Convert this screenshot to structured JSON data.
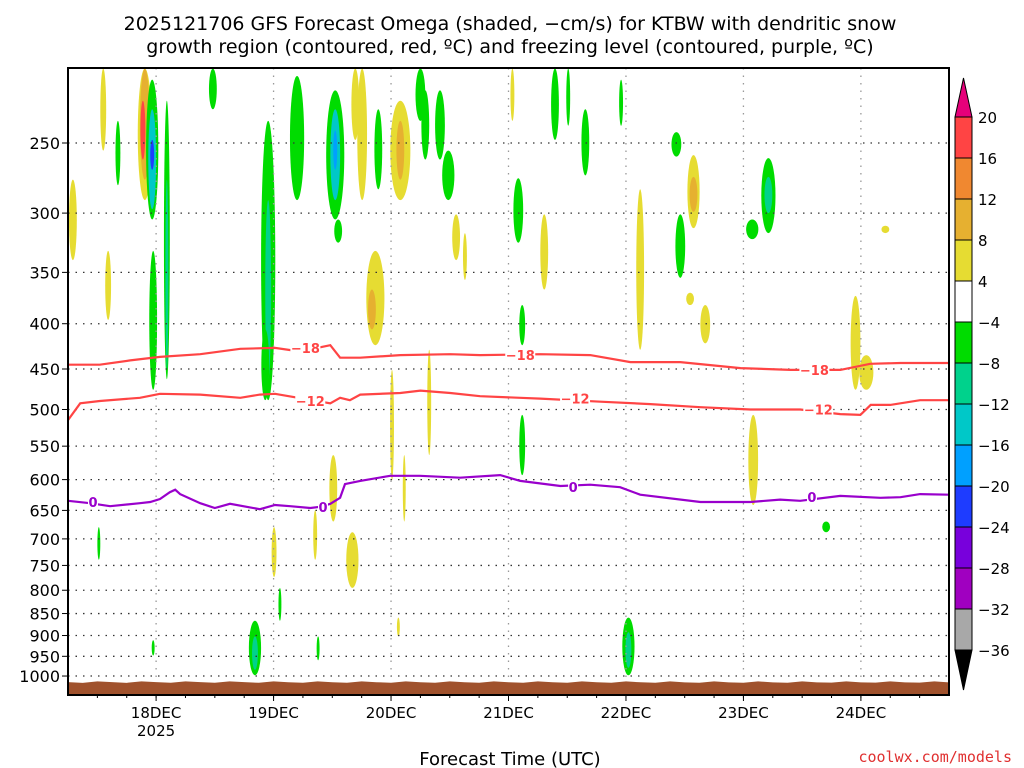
{
  "chart_data": {
    "type": "heatmap",
    "title_line1": "2025121706 GFS Forecast Omega (shaded, −cm/s) for KTBW with dendritic snow",
    "title_line2": "growth region (contoured, red, ºC) and freezing level (contoured, purple, ºC)",
    "xlabel": "Forecast Time (UTC)",
    "credit": "coolwx.com/models",
    "x_units": "hours since 2025-12-17 06Z",
    "xlim": [
      0,
      180
    ],
    "ylim_hPa": [
      206,
      1050
    ],
    "y_scale": "log",
    "y_ticks": [
      250,
      300,
      350,
      400,
      450,
      500,
      550,
      600,
      650,
      700,
      750,
      800,
      850,
      900,
      950,
      1000
    ],
    "x_ticks": [
      {
        "hour": 18,
        "label": "18DEC",
        "sub": "2025"
      },
      {
        "hour": 42,
        "label": "19DEC",
        "sub": ""
      },
      {
        "hour": 66,
        "label": "20DEC",
        "sub": ""
      },
      {
        "hour": 90,
        "label": "21DEC",
        "sub": ""
      },
      {
        "hour": 114,
        "label": "22DEC",
        "sub": ""
      },
      {
        "hour": 138,
        "label": "23DEC",
        "sub": ""
      },
      {
        "hour": 162,
        "label": "24DEC",
        "sub": ""
      }
    ],
    "grid": true,
    "colorbar": {
      "labels": [
        "20",
        "16",
        "12",
        "8",
        "4",
        "−4",
        "−8",
        "−12",
        "−16",
        "−20",
        "−24",
        "−28",
        "−32",
        "−36"
      ],
      "colors": [
        "#ff4444",
        "#f08830",
        "#e6b030",
        "#e6dc32",
        "#ffffff",
        "#00dc00",
        "#00d28c",
        "#00c8c8",
        "#00a0ff",
        "#1e3cff",
        "#7800dc",
        "#a000c0",
        "#a8a8a8"
      ],
      "over_color": "#e6007a",
      "under_color": "#000000"
    },
    "surface_pressure_hPa": 1016,
    "surface_color": "#a0522d",
    "omega_regions_fields": [
      "hour_center",
      "hour_width",
      "p_top",
      "p_bottom",
      "omega"
    ],
    "omega_regions": [
      [
        1.0,
        1.6,
        275,
        339,
        6
      ],
      [
        7.2,
        1.2,
        206,
        255,
        6
      ],
      [
        8.2,
        1.2,
        331,
        396,
        6
      ],
      [
        10.2,
        1.0,
        236,
        279,
        -6
      ],
      [
        15.7,
        2.9,
        206,
        290,
        6
      ],
      [
        15.7,
        2.0,
        206,
        275,
        10
      ],
      [
        15.3,
        1.0,
        224,
        261,
        18
      ],
      [
        17.2,
        2.5,
        212,
        305,
        -6
      ],
      [
        17.2,
        1.6,
        229,
        297,
        -14
      ],
      [
        17.2,
        0.8,
        248,
        268,
        -22
      ],
      [
        17.4,
        1.6,
        331,
        475,
        -6
      ],
      [
        20.2,
        1.2,
        224,
        462,
        -6
      ],
      [
        20.2,
        0.6,
        275,
        451,
        -10
      ],
      [
        29.6,
        1.6,
        206,
        229,
        -6
      ],
      [
        40.9,
        2.9,
        236,
        488,
        -6
      ],
      [
        40.9,
        1.2,
        290,
        462,
        -10
      ],
      [
        40.3,
        1.6,
        406,
        488,
        -6
      ],
      [
        46.8,
        2.9,
        210,
        290,
        -6
      ],
      [
        54.6,
        3.7,
        218,
        305,
        -6
      ],
      [
        54.6,
        2.0,
        229,
        290,
        -14
      ],
      [
        54.6,
        0.8,
        242,
        268,
        -18
      ],
      [
        55.2,
        1.6,
        305,
        324,
        -6
      ],
      [
        58.7,
        1.6,
        206,
        248,
        6
      ],
      [
        60.1,
        2.0,
        206,
        290,
        6
      ],
      [
        62.8,
        3.7,
        331,
        423,
        6
      ],
      [
        62.1,
        1.6,
        366,
        406,
        10
      ],
      [
        63.4,
        1.6,
        229,
        282,
        -6
      ],
      [
        67.9,
        4.1,
        224,
        290,
        6
      ],
      [
        67.9,
        1.6,
        236,
        275,
        10
      ],
      [
        72.0,
        2.0,
        206,
        236,
        -6
      ],
      [
        73.0,
        1.6,
        218,
        261,
        -6
      ],
      [
        76.0,
        2.0,
        218,
        261,
        -6
      ],
      [
        77.7,
        2.5,
        255,
        290,
        -6
      ],
      [
        79.3,
        1.6,
        301,
        339,
        6
      ],
      [
        81.1,
        0.8,
        316,
        357,
        6
      ],
      [
        90.8,
        0.8,
        206,
        236,
        6
      ],
      [
        92.0,
        2.0,
        274,
        324,
        -6
      ],
      [
        97.3,
        1.6,
        301,
        366,
        6
      ],
      [
        99.5,
        1.6,
        206,
        248,
        -6
      ],
      [
        102.2,
        0.8,
        206,
        239,
        -6
      ],
      [
        105.7,
        1.6,
        229,
        272,
        -6
      ],
      [
        113.0,
        0.8,
        212,
        239,
        -6
      ],
      [
        116.9,
        1.6,
        282,
        428,
        6
      ],
      [
        124.3,
        2.0,
        243,
        259,
        -6
      ],
      [
        127.8,
        2.5,
        258,
        312,
        6
      ],
      [
        127.8,
        1.6,
        273,
        299,
        10
      ],
      [
        125.1,
        2.0,
        301,
        355,
        -6
      ],
      [
        130.2,
        2.0,
        381,
        421,
        6
      ],
      [
        127.1,
        1.6,
        369,
        381,
        6
      ],
      [
        143.1,
        2.9,
        260,
        316,
        -6
      ],
      [
        143.1,
        1.6,
        273,
        300,
        -10
      ],
      [
        139.8,
        2.5,
        305,
        321,
        -6
      ],
      [
        167.0,
        1.6,
        310,
        316,
        6
      ],
      [
        92.8,
        1.2,
        381,
        423,
        -6
      ],
      [
        160.9,
        2.0,
        372,
        475,
        6
      ],
      [
        163.1,
        2.9,
        434,
        475,
        6
      ],
      [
        140.0,
        2.0,
        507,
        641,
        6
      ],
      [
        154.9,
        1.6,
        669,
        688,
        -6
      ],
      [
        38.2,
        2.5,
        866,
        998,
        -6
      ],
      [
        38.2,
        1.2,
        902,
        984,
        -10
      ],
      [
        114.5,
        2.5,
        859,
        998,
        -6
      ],
      [
        114.5,
        1.2,
        892,
        979,
        -10
      ],
      [
        17.4,
        0.6,
        911,
        948,
        -6
      ],
      [
        51.1,
        0.6,
        902,
        960,
        -6
      ],
      [
        6.3,
        0.6,
        679,
        739,
        -6
      ],
      [
        43.3,
        0.6,
        795,
        866,
        -6
      ],
      [
        42.1,
        1.0,
        679,
        773,
        6
      ],
      [
        54.2,
        1.6,
        563,
        669,
        6
      ],
      [
        58.1,
        2.5,
        688,
        795,
        6
      ],
      [
        50.5,
        0.8,
        650,
        739,
        6
      ],
      [
        67.5,
        0.6,
        859,
        902,
        6
      ],
      [
        73.8,
        0.8,
        428,
        563,
        6
      ],
      [
        66.2,
        0.8,
        451,
        601,
        6
      ],
      [
        92.8,
        1.2,
        507,
        593,
        -6
      ],
      [
        68.7,
        0.6,
        563,
        669,
        6
      ]
    ],
    "contours": [
      {
        "name": "-18",
        "label": "−18",
        "color": "#ff4444",
        "hours": [
          0,
          6.5,
          12.7,
          18.8,
          27,
          35.2,
          42.3,
          47.4,
          53.6,
          55.6,
          59.7,
          67.9,
          78.1,
          84.2,
          96.5,
          106.7,
          114.9,
          125.1,
          137.4,
          147.6,
          157.8,
          163.9,
          170.1,
          180
        ],
        "p": [
          445,
          445,
          440,
          436,
          433,
          427,
          426,
          430,
          423,
          437,
          437,
          434,
          433,
          434,
          433,
          434,
          442,
          442,
          449,
          451,
          451,
          444,
          443,
          443
        ],
        "labels_at": [
          [
            48.5,
            426
          ],
          [
            92.4,
            434
          ],
          [
            152.5,
            451
          ]
        ]
      },
      {
        "name": "-12",
        "label": "−12",
        "color": "#ff4444",
        "hours": [
          0,
          2.5,
          6.5,
          14.7,
          18.8,
          27,
          35.2,
          39.2,
          42.3,
          53.6,
          55.6,
          57.6,
          59.7,
          67.9,
          72,
          78.1,
          84.2,
          92.4,
          96.5,
          108.8,
          119,
          129.2,
          139.4,
          149.6,
          157.8,
          161.9,
          164,
          168,
          174.1,
          180
        ],
        "p": [
          514,
          492,
          489,
          485,
          480,
          481,
          485,
          481,
          480,
          492,
          485,
          488,
          481,
          479,
          476,
          479,
          483,
          485,
          486,
          490,
          493,
          497,
          500,
          500,
          506,
          507,
          494,
          494,
          488,
          488
        ],
        "labels_at": [
          [
            49.5,
            489
          ],
          [
            103.6,
            486
          ],
          [
            153.3,
            500
          ]
        ]
      },
      {
        "name": "0",
        "label": "0",
        "color": "#9900cc",
        "hours": [
          0,
          4.5,
          8.6,
          14.7,
          16.8,
          18.8,
          20.8,
          21.9,
          22.9,
          27,
          30,
          33.1,
          39.2,
          42.3,
          45.4,
          49.5,
          51.5,
          53.6,
          55.6,
          56.6,
          59.7,
          65.8,
          71.9,
          80.1,
          88.3,
          92.4,
          100.6,
          106.7,
          112.8,
          116.9,
          129.2,
          139.4,
          145.5,
          149.6,
          157.8,
          166,
          170.1,
          174.1,
          180
        ],
        "p": [
          634,
          638,
          643,
          638,
          636,
          631,
          620,
          616,
          623,
          638,
          646,
          639,
          648,
          641,
          643,
          646,
          644,
          639,
          629,
          607,
          602,
          594,
          594,
          597,
          593,
          602,
          610,
          608,
          612,
          624,
          636,
          636,
          632,
          634,
          626,
          629,
          628,
          623,
          624
        ],
        "labels_at": [
          [
            5.1,
            636
          ],
          [
            52.1,
            644
          ],
          [
            103.2,
            612
          ],
          [
            152,
            628
          ]
        ]
      }
    ]
  }
}
